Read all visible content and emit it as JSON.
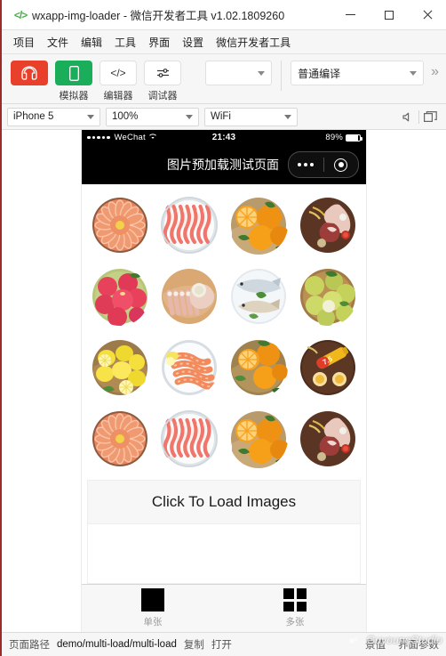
{
  "window": {
    "icon": "code-brackets-icon",
    "title": "wxapp-img-loader - 微信开发者工具 v1.02.1809260",
    "minimize_label": "minimize",
    "maximize_label": "maximize",
    "close_label": "close"
  },
  "menubar": {
    "items": [
      {
        "label": "项目"
      },
      {
        "label": "文件"
      },
      {
        "label": "编辑"
      },
      {
        "label": "工具"
      },
      {
        "label": "界面"
      },
      {
        "label": "设置"
      },
      {
        "label": "微信开发者工具"
      }
    ]
  },
  "toolbar": {
    "tools": [
      {
        "label": "",
        "icon": "user-avatar-icon",
        "style": "red"
      },
      {
        "label": "模拟器",
        "icon": "phone-icon",
        "style": "green"
      },
      {
        "label": "编辑器",
        "icon": "code-icon",
        "style": "plain"
      },
      {
        "label": "调试器",
        "icon": "sliders-icon",
        "style": "plain"
      }
    ],
    "blank_select": {
      "value": "",
      "caret": "chevron-down-icon"
    },
    "compile_select": {
      "value": "普通编译",
      "caret": "chevron-down-icon"
    },
    "overflow": "»"
  },
  "devicebar": {
    "device": {
      "value": "iPhone 5"
    },
    "zoom": {
      "value": "100%"
    },
    "network": {
      "value": "WiFi"
    },
    "mute_icon": "speaker-mute-icon",
    "window_icon": "detach-window-icon"
  },
  "simulator": {
    "statusbar": {
      "carrier": "WeChat",
      "signal_icon": "signal-dots-icon",
      "wifi_icon": "wifi-icon",
      "time": "21:43",
      "battery_percent": "89%",
      "battery_level": 89
    },
    "navbar": {
      "title": "图片预加载测试页面",
      "menu_icon": "more-dots-icon",
      "target_icon": "target-circle-icon"
    },
    "grid": {
      "columns": 4,
      "items": [
        {
          "name": "salmon-sashimi-platter",
          "type": "salmon"
        },
        {
          "name": "sliced-pork-belly-plate",
          "type": "pork"
        },
        {
          "name": "oranges-basket",
          "type": "orange"
        },
        {
          "name": "lamb-leg-cutting-board",
          "type": "lamb"
        },
        {
          "name": "red-apples-bowl",
          "type": "apple"
        },
        {
          "name": "pork-ribs-cutting-board",
          "type": "ribs"
        },
        {
          "name": "fresh-fish-plate",
          "type": "fish"
        },
        {
          "name": "green-pears-bowl",
          "type": "pear"
        },
        {
          "name": "lemons-bowl",
          "type": "lemon"
        },
        {
          "name": "cooked-shrimp-plate",
          "type": "shrimp"
        },
        {
          "name": "oranges-bowl",
          "type": "orange2"
        },
        {
          "name": "beer-bottle-board",
          "type": "beer"
        },
        {
          "name": "salmon-sashimi-platter",
          "type": "salmon"
        },
        {
          "name": "sliced-pork-belly-plate",
          "type": "pork"
        },
        {
          "name": "oranges-basket",
          "type": "orange"
        },
        {
          "name": "lamb-leg-cutting-board",
          "type": "lamb"
        }
      ]
    },
    "load_button": {
      "label": "Click To Load Images"
    },
    "tabbar": {
      "tabs": [
        {
          "label": "单张",
          "icon": "single-square-icon"
        },
        {
          "label": "多张",
          "icon": "four-squares-icon"
        }
      ]
    }
  },
  "statusfoot": {
    "path_label": "页面路径",
    "path_value": "demo/multi-load/multi-load",
    "copy_label": "复制",
    "open_label": "打开",
    "right_items": [
      {
        "label": "景值"
      },
      {
        "label": "界面参数"
      }
    ],
    "watermark": "GuyoungStudio"
  }
}
